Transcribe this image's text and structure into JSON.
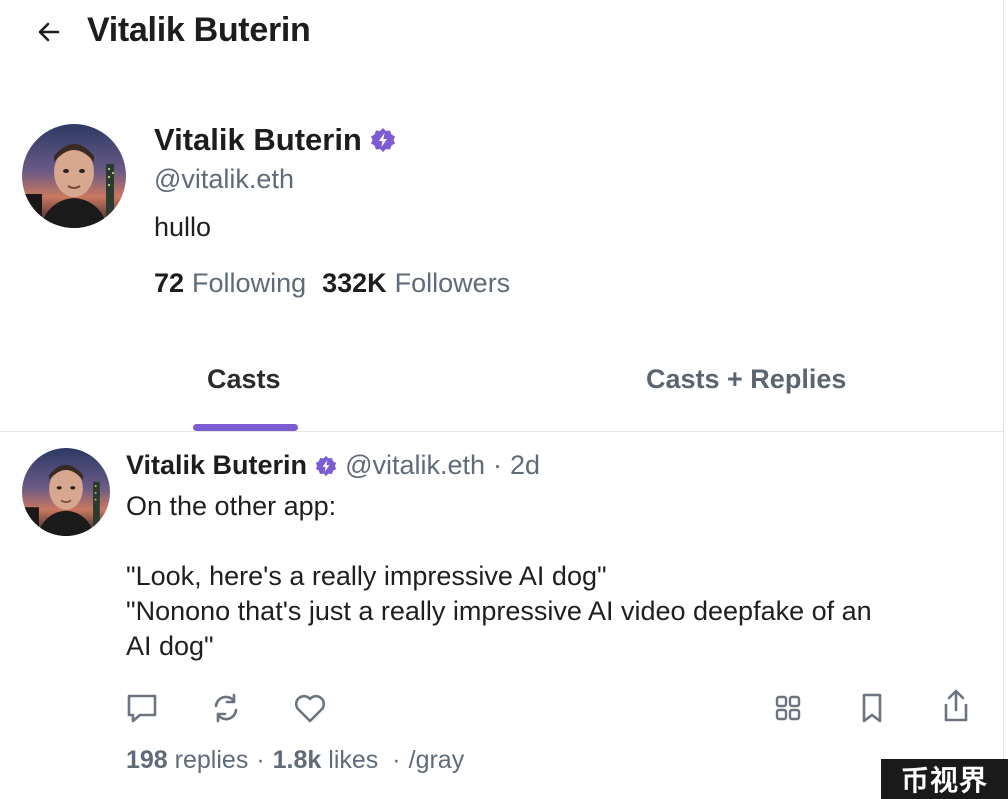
{
  "header": {
    "title": "Vitalik Buterin",
    "back_icon": "arrow-left-icon"
  },
  "profile": {
    "name": "Vitalik Buterin",
    "handle": "@vitalik.eth",
    "bio": "hullo",
    "following_count": "72",
    "following_label": "Following",
    "followers_count": "332K",
    "followers_label": "Followers",
    "badge_icon": "verified-badge-icon"
  },
  "tabs": [
    {
      "label": "Casts",
      "active": true
    },
    {
      "label": "Casts + Replies",
      "active": false
    }
  ],
  "cast": {
    "author_name": "Vitalik Buterin",
    "author_handle": "@vitalik.eth",
    "separator": "·",
    "time": "2d",
    "lines": [
      "On the other app:",
      "",
      "\"Look, here's a really impressive AI dog\"",
      "\"Nonono that's just a really impressive AI video deepfake of an",
      "AI dog\""
    ],
    "replies_count": "198",
    "replies_label": "replies",
    "likes_count": "1.8k",
    "likes_label": "likes",
    "channel": "/gray"
  },
  "watermark": "币视界",
  "colors": {
    "accent": "#7d5bd1",
    "muted_text": "#5f6b7a",
    "icon_gray": "#6b7480"
  }
}
